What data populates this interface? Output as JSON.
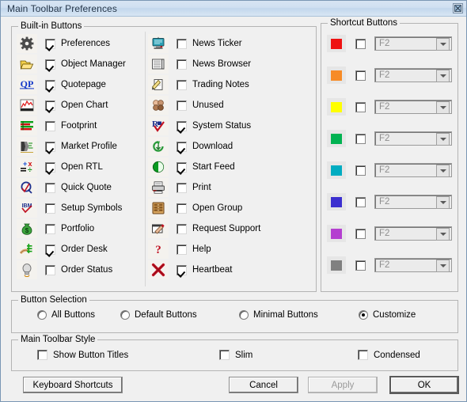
{
  "window": {
    "title": "Main Toolbar Preferences",
    "close_icon": "close-icon",
    "accent": "#cfe0f1",
    "background": "#f0f0f0"
  },
  "builtin": {
    "legend": "Built-in Buttons",
    "left_column": [
      {
        "icon": "gear-icon",
        "label": "Preferences",
        "checked": true
      },
      {
        "icon": "open-folder-icon",
        "label": "Object Manager",
        "checked": true
      },
      {
        "icon": "qp-icon",
        "label": "Quotepage",
        "checked": true
      },
      {
        "icon": "line-chart-icon",
        "label": "Open Chart",
        "checked": true
      },
      {
        "icon": "footprint-bars-icon",
        "label": "Footprint",
        "checked": false
      },
      {
        "icon": "market-profile-icon",
        "label": "Market Profile",
        "checked": true
      },
      {
        "icon": "calculator-icon",
        "label": "Open RTL",
        "checked": true
      },
      {
        "icon": "quick-quote-icon",
        "label": "Quick Quote",
        "checked": false
      },
      {
        "icon": "ibm-symbol-icon",
        "label": "Setup Symbols",
        "checked": false
      },
      {
        "icon": "money-bag-icon",
        "label": "Portfolio",
        "checked": false
      },
      {
        "icon": "order-desk-icon",
        "label": "Order Desk",
        "checked": true
      },
      {
        "icon": "light-bulb-icon",
        "label": "Order Status",
        "checked": false
      }
    ],
    "middle_column": [
      {
        "icon": "news-ticker-icon",
        "label": "News Ticker",
        "checked": false
      },
      {
        "icon": "news-browser-icon",
        "label": "News Browser",
        "checked": false
      },
      {
        "icon": "trading-notes-icon",
        "label": "Trading Notes",
        "checked": false
      },
      {
        "icon": "unused-icon",
        "label": "Unused",
        "checked": false
      },
      {
        "icon": "system-status-icon",
        "label": "System Status",
        "checked": true
      },
      {
        "icon": "download-icon",
        "label": "Download",
        "checked": true
      },
      {
        "icon": "start-feed-icon",
        "label": "Start Feed",
        "checked": true
      },
      {
        "icon": "printer-icon",
        "label": "Print",
        "checked": false
      },
      {
        "icon": "open-group-icon",
        "label": "Open Group",
        "checked": false
      },
      {
        "icon": "request-support-icon",
        "label": "Request Support",
        "checked": false
      },
      {
        "icon": "help-icon",
        "label": "Help",
        "checked": false
      },
      {
        "icon": "heartbeat-icon",
        "label": "Heartbeat",
        "checked": true
      }
    ]
  },
  "shortcut": {
    "legend": "Shortcut Buttons",
    "rows": [
      {
        "color": "#ee1111",
        "checked": false,
        "key": "F2"
      },
      {
        "color": "#f78b26",
        "checked": false,
        "key": "F2"
      },
      {
        "color": "#ffff00",
        "checked": false,
        "key": "F2"
      },
      {
        "color": "#00b251",
        "checked": false,
        "key": "F2"
      },
      {
        "color": "#00acc1",
        "checked": false,
        "key": "F2"
      },
      {
        "color": "#3b2fcf",
        "checked": false,
        "key": "F2"
      },
      {
        "color": "#b43fd0",
        "checked": false,
        "key": "F2"
      },
      {
        "color": "#808080",
        "checked": false,
        "key": "F2"
      }
    ],
    "key_options": [
      "F2"
    ]
  },
  "button_selection": {
    "legend": "Button Selection",
    "options": [
      {
        "label": "All Buttons",
        "selected": false
      },
      {
        "label": "Default Buttons",
        "selected": false
      },
      {
        "label": "Minimal Buttons",
        "selected": false
      },
      {
        "label": "Customize",
        "selected": true
      }
    ]
  },
  "toolbar_style": {
    "legend": "Main Toolbar Style",
    "options": [
      {
        "label": "Show Button Titles",
        "checked": false
      },
      {
        "label": "Slim",
        "checked": false
      },
      {
        "label": "Condensed",
        "checked": false
      }
    ]
  },
  "footer": {
    "keyboard_shortcuts": "Keyboard Shortcuts",
    "cancel": "Cancel",
    "apply": "Apply",
    "apply_disabled": true,
    "ok": "OK"
  }
}
